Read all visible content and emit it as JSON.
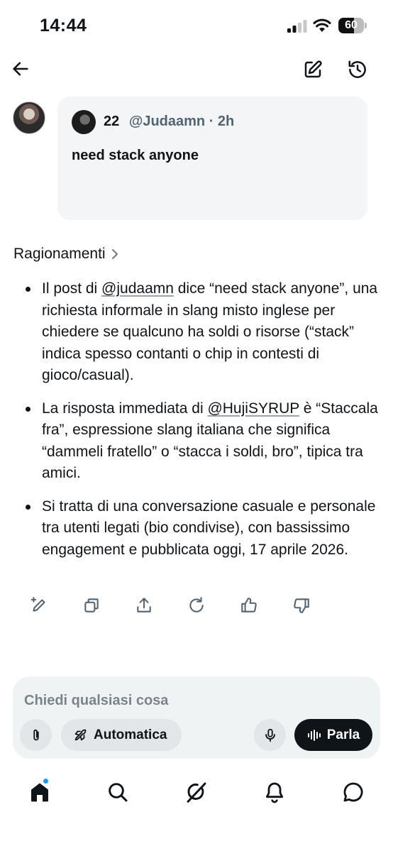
{
  "status_bar": {
    "time": "14:44",
    "battery": "60",
    "battery_level": 0.6
  },
  "top_bar": {
    "back_icon": "arrow-left-icon",
    "edit_icon": "edit-icon",
    "history_icon": "history-icon"
  },
  "quoted_post": {
    "name": "22",
    "handle": "@Judaamn",
    "separator": "·",
    "time": "2h",
    "text": "need stack anyone"
  },
  "reasoning_label": "Ragionamenti",
  "bullets": [
    {
      "pre": "Il post di ",
      "mention": "@judaamn",
      "post": "  dice “need stack anyone”, una richiesta informale in slang misto inglese per chiedere se qualcuno ha soldi o risorse (“stack” indica spesso contanti o chip in contesti di gioco/casual)."
    },
    {
      "pre": "La risposta immediata di ",
      "mention": "@HujiSYRUP",
      "post": "  è “Staccala fra”, espressione slang italiana che significa “dammeli fratello” o “stacca i soldi, bro”, tipica tra amici."
    },
    {
      "pre": "Si tratta di una conversazione casuale e personale tra utenti legati (bio condivise), con bassissimo engagement e pubblicata oggi, 17 aprile 2026.",
      "mention": "",
      "post": ""
    }
  ],
  "actions": [
    "rewrite-icon",
    "copy-icon",
    "share-icon",
    "regenerate-icon",
    "thumbs-up-icon",
    "thumbs-down-icon"
  ],
  "composer": {
    "placeholder": "Chiedi qualsiasi cosa",
    "mode_label": "Automatica",
    "talk_label": "Parla"
  },
  "bottom_nav": [
    "home-icon",
    "search-icon",
    "grok-icon",
    "notifications-icon",
    "messages-icon"
  ],
  "colors": {
    "accent": "#1d9bf0",
    "text": "#0f1419",
    "muted": "#536471",
    "card": "#f4f5f6"
  }
}
